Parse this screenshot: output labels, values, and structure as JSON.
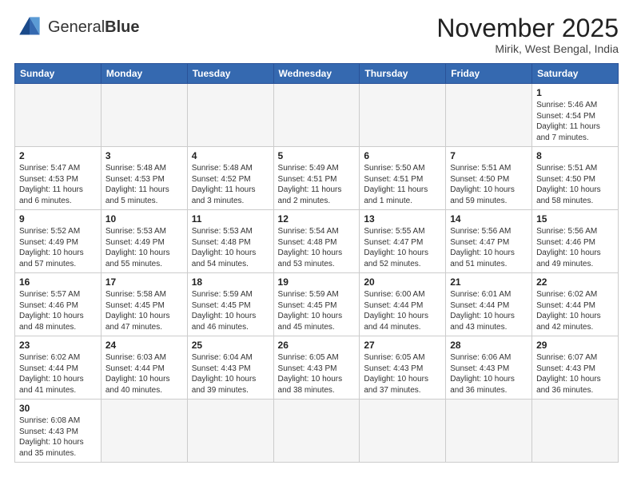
{
  "header": {
    "logo_text_normal": "General",
    "logo_text_bold": "Blue",
    "month_title": "November 2025",
    "subtitle": "Mirik, West Bengal, India"
  },
  "weekdays": [
    "Sunday",
    "Monday",
    "Tuesday",
    "Wednesday",
    "Thursday",
    "Friday",
    "Saturday"
  ],
  "weeks": [
    [
      {
        "day": "",
        "info": ""
      },
      {
        "day": "",
        "info": ""
      },
      {
        "day": "",
        "info": ""
      },
      {
        "day": "",
        "info": ""
      },
      {
        "day": "",
        "info": ""
      },
      {
        "day": "",
        "info": ""
      },
      {
        "day": "1",
        "info": "Sunrise: 5:46 AM\nSunset: 4:54 PM\nDaylight: 11 hours\nand 7 minutes."
      }
    ],
    [
      {
        "day": "2",
        "info": "Sunrise: 5:47 AM\nSunset: 4:53 PM\nDaylight: 11 hours\nand 6 minutes."
      },
      {
        "day": "3",
        "info": "Sunrise: 5:48 AM\nSunset: 4:53 PM\nDaylight: 11 hours\nand 5 minutes."
      },
      {
        "day": "4",
        "info": "Sunrise: 5:48 AM\nSunset: 4:52 PM\nDaylight: 11 hours\nand 3 minutes."
      },
      {
        "day": "5",
        "info": "Sunrise: 5:49 AM\nSunset: 4:51 PM\nDaylight: 11 hours\nand 2 minutes."
      },
      {
        "day": "6",
        "info": "Sunrise: 5:50 AM\nSunset: 4:51 PM\nDaylight: 11 hours\nand 1 minute."
      },
      {
        "day": "7",
        "info": "Sunrise: 5:51 AM\nSunset: 4:50 PM\nDaylight: 10 hours\nand 59 minutes."
      },
      {
        "day": "8",
        "info": "Sunrise: 5:51 AM\nSunset: 4:50 PM\nDaylight: 10 hours\nand 58 minutes."
      }
    ],
    [
      {
        "day": "9",
        "info": "Sunrise: 5:52 AM\nSunset: 4:49 PM\nDaylight: 10 hours\nand 57 minutes."
      },
      {
        "day": "10",
        "info": "Sunrise: 5:53 AM\nSunset: 4:49 PM\nDaylight: 10 hours\nand 55 minutes."
      },
      {
        "day": "11",
        "info": "Sunrise: 5:53 AM\nSunset: 4:48 PM\nDaylight: 10 hours\nand 54 minutes."
      },
      {
        "day": "12",
        "info": "Sunrise: 5:54 AM\nSunset: 4:48 PM\nDaylight: 10 hours\nand 53 minutes."
      },
      {
        "day": "13",
        "info": "Sunrise: 5:55 AM\nSunset: 4:47 PM\nDaylight: 10 hours\nand 52 minutes."
      },
      {
        "day": "14",
        "info": "Sunrise: 5:56 AM\nSunset: 4:47 PM\nDaylight: 10 hours\nand 51 minutes."
      },
      {
        "day": "15",
        "info": "Sunrise: 5:56 AM\nSunset: 4:46 PM\nDaylight: 10 hours\nand 49 minutes."
      }
    ],
    [
      {
        "day": "16",
        "info": "Sunrise: 5:57 AM\nSunset: 4:46 PM\nDaylight: 10 hours\nand 48 minutes."
      },
      {
        "day": "17",
        "info": "Sunrise: 5:58 AM\nSunset: 4:45 PM\nDaylight: 10 hours\nand 47 minutes."
      },
      {
        "day": "18",
        "info": "Sunrise: 5:59 AM\nSunset: 4:45 PM\nDaylight: 10 hours\nand 46 minutes."
      },
      {
        "day": "19",
        "info": "Sunrise: 5:59 AM\nSunset: 4:45 PM\nDaylight: 10 hours\nand 45 minutes."
      },
      {
        "day": "20",
        "info": "Sunrise: 6:00 AM\nSunset: 4:44 PM\nDaylight: 10 hours\nand 44 minutes."
      },
      {
        "day": "21",
        "info": "Sunrise: 6:01 AM\nSunset: 4:44 PM\nDaylight: 10 hours\nand 43 minutes."
      },
      {
        "day": "22",
        "info": "Sunrise: 6:02 AM\nSunset: 4:44 PM\nDaylight: 10 hours\nand 42 minutes."
      }
    ],
    [
      {
        "day": "23",
        "info": "Sunrise: 6:02 AM\nSunset: 4:44 PM\nDaylight: 10 hours\nand 41 minutes."
      },
      {
        "day": "24",
        "info": "Sunrise: 6:03 AM\nSunset: 4:44 PM\nDaylight: 10 hours\nand 40 minutes."
      },
      {
        "day": "25",
        "info": "Sunrise: 6:04 AM\nSunset: 4:43 PM\nDaylight: 10 hours\nand 39 minutes."
      },
      {
        "day": "26",
        "info": "Sunrise: 6:05 AM\nSunset: 4:43 PM\nDaylight: 10 hours\nand 38 minutes."
      },
      {
        "day": "27",
        "info": "Sunrise: 6:05 AM\nSunset: 4:43 PM\nDaylight: 10 hours\nand 37 minutes."
      },
      {
        "day": "28",
        "info": "Sunrise: 6:06 AM\nSunset: 4:43 PM\nDaylight: 10 hours\nand 36 minutes."
      },
      {
        "day": "29",
        "info": "Sunrise: 6:07 AM\nSunset: 4:43 PM\nDaylight: 10 hours\nand 36 minutes."
      }
    ],
    [
      {
        "day": "30",
        "info": "Sunrise: 6:08 AM\nSunset: 4:43 PM\nDaylight: 10 hours\nand 35 minutes."
      },
      {
        "day": "",
        "info": ""
      },
      {
        "day": "",
        "info": ""
      },
      {
        "day": "",
        "info": ""
      },
      {
        "day": "",
        "info": ""
      },
      {
        "day": "",
        "info": ""
      },
      {
        "day": "",
        "info": ""
      }
    ]
  ]
}
